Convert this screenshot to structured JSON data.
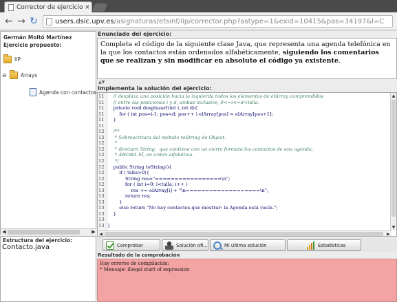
{
  "browser": {
    "tab_title": "Corrector de ejercicios - I",
    "tab_close": "×",
    "url_host": "users.dsic.upv.es",
    "url_path": "/asignaturas/etsinf/iip/corrector.php?astype=1&exid=10415&pas=34197&l=C"
  },
  "sidebar": {
    "user_name": "Germán Moltó Martínez",
    "proposed_label": "Ejercicio propuesto:",
    "tree": [
      {
        "label": "IIP",
        "icon": "folder-icon"
      },
      {
        "label": "Arrays",
        "icon": "folder-icon",
        "expander": "⊖"
      },
      {
        "label": "Agenda con contactos",
        "icon": "file-icon"
      }
    ],
    "structure_label": "Estructura del ejercicio:",
    "structure_item": "Contacto.java"
  },
  "statement": {
    "label": "Enunciado del ejercicio:",
    "text_1": "Completa el código de la siguiente clase Java, que representa una agenda telefónica en la que los contactos están ordenados alfabéticamente, ",
    "text_bold": "siguiendo los comentarios que se realizan y sin modificar en absoluto el código ya existente",
    "text_2": "."
  },
  "editor": {
    "label": "Implementa la solución del ejercicio:",
    "lines": [
      {
        "n": "11",
        "t": "    // desplaza una posición hacia la izquierda todos los elementos de elArray comprendidos",
        "k": "comment"
      },
      {
        "n": "11",
        "t": "    // entre las posiciones i y d, ambas inclusive, 0<=i<=d<talla.",
        "k": "comment"
      },
      {
        "n": "11",
        "t": "    private void desplazarI(int i, int d){",
        "k": "kw"
      },
      {
        "n": "11",
        "t": "        for ( int pos=i-1; pos<d; pos++ ) elArray[pos] = elArray[pos+1];",
        "k": "kw"
      },
      {
        "n": "11",
        "t": "    }",
        "k": "kw"
      },
      {
        "n": "11",
        "t": "",
        "k": "kw"
      },
      {
        "n": "12",
        "t": "    /**",
        "k": "comment"
      },
      {
        "n": "12",
        "t": "     * Sobrescritura del método toString de Object.",
        "k": "comment"
      },
      {
        "n": "12",
        "t": "     *",
        "k": "comment"
      },
      {
        "n": "12",
        "t": "     * @return String,  que contiene con un cierto formato los contactos de una agenda,",
        "k": "comment"
      },
      {
        "n": "12",
        "t": "     * AHORA SÍ, en orden alfabético.",
        "k": "comment"
      },
      {
        "n": "12",
        "t": "     */",
        "k": "comment"
      },
      {
        "n": "12",
        "t": "    public String toString(){",
        "k": "kw"
      },
      {
        "n": "12",
        "t": "        if ( talla>0){",
        "k": "kw"
      },
      {
        "n": "12",
        "t": "            String res=\"=================\\n\";",
        "k": "str"
      },
      {
        "n": "12",
        "t": "            for ( int i=0; i<talla; i++ )",
        "k": "kw"
      },
      {
        "n": "13",
        "t": "                res += elArray[i] + \"\\n===================\\n\";",
        "k": "str"
      },
      {
        "n": "13",
        "t": "            return res;",
        "k": "kw"
      },
      {
        "n": "13",
        "t": "        }",
        "k": "kw"
      },
      {
        "n": "13",
        "t": "        else return \"No hay contactos que mostrar: la Agenda está vacía.\";",
        "k": "str"
      },
      {
        "n": "13",
        "t": "    }",
        "k": "kw"
      },
      {
        "n": "13",
        "t": "",
        "k": "kw"
      },
      {
        "n": "13",
        "t": "}",
        "k": "kw"
      }
    ]
  },
  "buttons": [
    {
      "label": "Comprobar",
      "icon": "check-icon"
    },
    {
      "label": "Solución ofi...",
      "icon": "person-icon"
    },
    {
      "label": "Mi última solución",
      "icon": "magnify-icon"
    },
    {
      "label": "Estadísticas",
      "icon": "bar-chart-icon"
    }
  ],
  "result": {
    "label": "Resultado de la comprobación",
    "text": "Hay errores de compilación:\n* Mensaje: illegal start of expression"
  },
  "colors": {
    "result_bg": "#f4a3a3",
    "comment": "#3f7f5f"
  }
}
